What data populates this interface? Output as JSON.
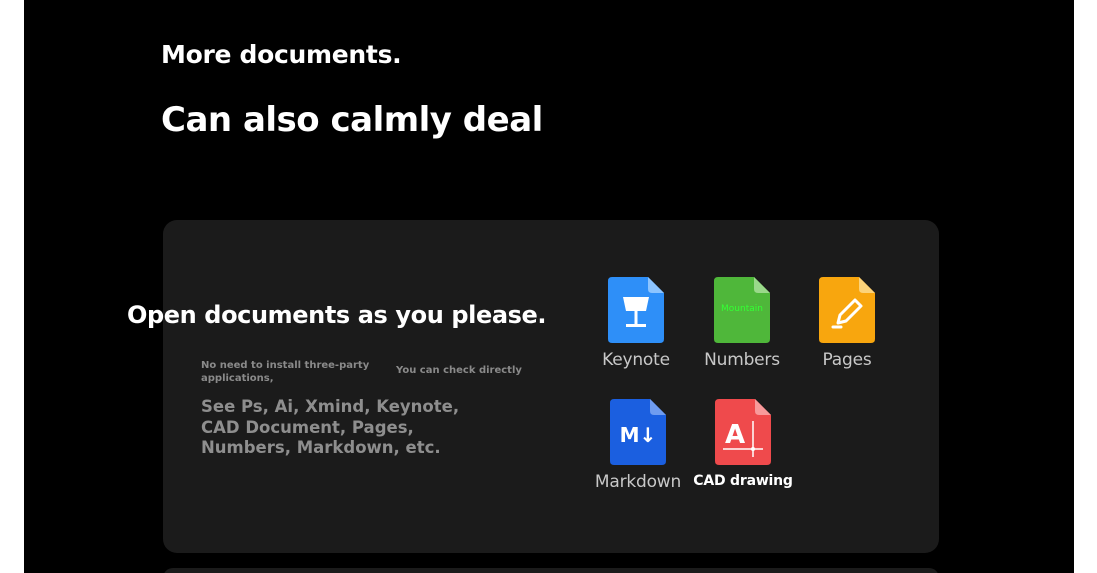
{
  "headline": {
    "line1": "More documents.",
    "line2": "Can also calmly deal"
  },
  "card": {
    "title": "Open documents as you please.",
    "note_left": "No need to install three-party applications,",
    "note_right": "You can check directly",
    "description": "See Ps, Ai, Xmind, Keynote, CAD Document, Pages, Numbers, Markdown, etc."
  },
  "apps": [
    {
      "label": "Keynote",
      "icon": "keynote-icon",
      "color": "#2e8ff8"
    },
    {
      "label": "Numbers",
      "icon": "numbers-icon",
      "color": "#4fb73a",
      "icon_text": "Mountain"
    },
    {
      "label": "Pages",
      "icon": "pages-icon",
      "color": "#f8a60e"
    },
    {
      "label": "Markdown",
      "icon": "markdown-icon",
      "color": "#1b5fe0",
      "icon_text": "M↓"
    },
    {
      "label": "CAD drawing",
      "icon": "cad-icon",
      "color": "#ef4a4c",
      "icon_text": "A"
    }
  ]
}
